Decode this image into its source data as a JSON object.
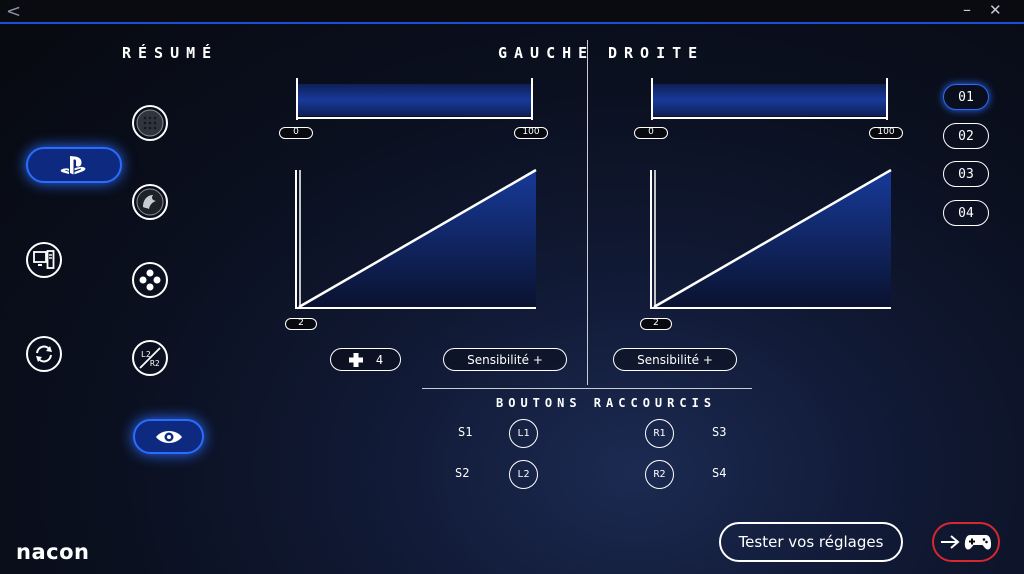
{
  "titlebar": {
    "back": "<",
    "minimize": "–",
    "close": "✕"
  },
  "sections": {
    "resume": "RÉSUMÉ",
    "gauche": "GAUCHE",
    "droite": "DROITE",
    "raccourcis": "BOUTONS RACCOURCIS"
  },
  "nav": {
    "items": [
      {
        "name": "playstation",
        "icon": "playstation-icon",
        "active": true
      },
      {
        "name": "pc",
        "icon": "pc-icon",
        "active": false
      },
      {
        "name": "sync",
        "icon": "sync-icon",
        "active": false
      }
    ]
  },
  "profiles": {
    "icons": [
      "speaker-grid-icon",
      "eagle-icon",
      "dpad-circle-icon",
      "r2-l2-icon",
      "eye-icon"
    ]
  },
  "left_stick": {
    "range_min": "0",
    "range_max": "100",
    "deadzone": "2",
    "range_fill": 1.0
  },
  "right_stick": {
    "range_min": "0",
    "range_max": "100",
    "deadzone": "2",
    "range_fill": 1.0
  },
  "controls": {
    "dpad_value": "4",
    "sensitivity_left": "Sensibilité +",
    "sensitivity_right": "Sensibilité +"
  },
  "slots": [
    "01",
    "02",
    "03",
    "04"
  ],
  "shortcuts": {
    "s1": "S1",
    "s2": "S2",
    "s3": "S3",
    "s4": "S4",
    "l1": "L1",
    "l2": "L2",
    "r1": "R1",
    "r2": "R2"
  },
  "footer": {
    "test_button": "Tester vos réglages",
    "logo": "nacon"
  },
  "colors": {
    "accent": "#2a6cff",
    "fill": "#12307a",
    "danger": "#d8272f"
  }
}
